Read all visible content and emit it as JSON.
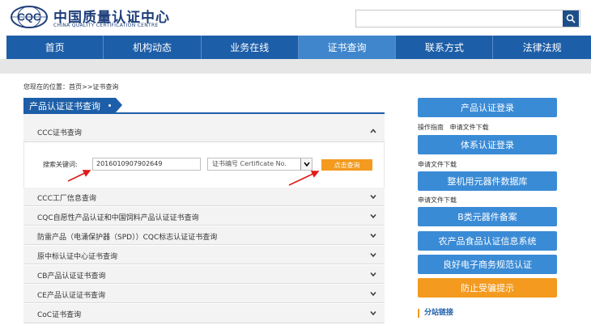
{
  "header": {
    "logo_mark": "CQC",
    "name_cn": "中国质量认证中心",
    "name_en": "CHINA QUALITY CERTIFICATION CENTRE",
    "search_placeholder": "",
    "search_icon": "search-icon"
  },
  "nav": {
    "items": [
      {
        "label": "首页"
      },
      {
        "label": "机构动态"
      },
      {
        "label": "业务在线"
      },
      {
        "label": "证书查询"
      },
      {
        "label": "联系方式"
      },
      {
        "label": "法律法规"
      }
    ],
    "active_index": 3
  },
  "breadcrumb": "您现在的位置：首页>>证书查询",
  "section_title": "产品认证证书查询",
  "accordion": {
    "open_item": {
      "label": "CCC证书查询",
      "keyword_label": "搜索关键词:",
      "keyword_value": "2016010907902649",
      "select_value": "证书编号 Certificate No.",
      "query_button": "点击查询"
    },
    "items": [
      {
        "label": "CCC工厂信息查询"
      },
      {
        "label": "CQC自愿性产品认证和中国饲料产品认证证书查询"
      },
      {
        "label": "防雷产品（电涌保护器（SPD））CQC标志认证证书查询"
      },
      {
        "label": "原中标认证中心证书查询"
      },
      {
        "label": "CB产品认证证书查询"
      },
      {
        "label": "CE产品认证证书查询"
      },
      {
        "label": "CoC证书查询"
      }
    ]
  },
  "sidebar": {
    "buttons": [
      {
        "label": "产品认证登录"
      },
      {
        "label": "体系认证登录"
      },
      {
        "label": "整机用元器件数据库"
      },
      {
        "label": "B类元器件备案"
      },
      {
        "label": "农产品食品认证信息系统"
      },
      {
        "label": "良好电子商务规范认证"
      },
      {
        "label": "防止受骗提示"
      }
    ],
    "sublinks": {
      "guide": "操作指南",
      "download_1": "申请文件下载",
      "download_2": "申请文件下载",
      "download_3": "申请文件下载"
    },
    "branch_title": "分站链接"
  },
  "colors": {
    "brand_blue": "#1d5ea8",
    "active_blue": "#3f86cc",
    "button_blue": "#3a8bd6",
    "accent_orange": "#f39a1f",
    "annotation_red": "#e01b1b"
  }
}
